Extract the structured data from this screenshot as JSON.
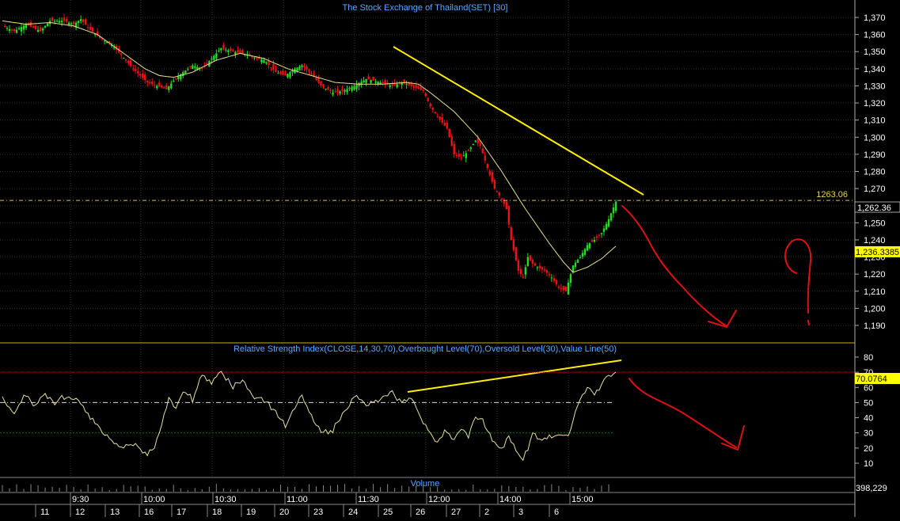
{
  "colors": {
    "background": "#000000",
    "grid": "#2f2f2f",
    "axis_text": "#ffffff",
    "title": "#5aa8ff",
    "up_candle": "#22dd22",
    "down_candle": "#ee1111",
    "moving_average": "#e8e090",
    "trendline": "#ffee00",
    "rsi_line": "#e8e0a0",
    "overbought": "#aa0000",
    "oversold": "#007700",
    "annotation": "#dd1111",
    "panel_border": "#c8b400"
  },
  "chart_data": [
    {
      "type": "candlestick",
      "title": "The Stock Exchange of Thailand(SET) [30]",
      "ylim": [
        1184,
        1377
      ],
      "yticks": [
        1190,
        1200,
        1210,
        1220,
        1230,
        1240,
        1250,
        1260,
        1270,
        1280,
        1290,
        1300,
        1310,
        1320,
        1330,
        1340,
        1350,
        1360,
        1370
      ],
      "yticklabels": [
        "1,190",
        "1,200",
        "1,210",
        "1,220",
        "1,230",
        "1,240",
        "1,250",
        "1,260",
        "1,270",
        "1,280",
        "1,290",
        "1,300",
        "1,310",
        "1,320",
        "1,330",
        "1,340",
        "1,350",
        "1,360",
        "1,370"
      ],
      "hline": {
        "value": 1263.06,
        "label": "1263.06"
      },
      "last_price_label": "1,262.36",
      "ma_label": "1,236.3385",
      "close_path": [
        [
          0,
          1365
        ],
        [
          5,
          1362
        ],
        [
          10,
          1366
        ],
        [
          16,
          1362
        ],
        [
          20,
          1368
        ],
        [
          26,
          1368
        ],
        [
          30,
          1366
        ],
        [
          33,
          1369
        ],
        [
          36,
          1364
        ],
        [
          41,
          1358
        ],
        [
          46,
          1354
        ],
        [
          50,
          1348
        ],
        [
          55,
          1340
        ],
        [
          58,
          1336
        ],
        [
          61,
          1332
        ],
        [
          65,
          1330
        ],
        [
          69,
          1328
        ],
        [
          72,
          1333
        ],
        [
          76,
          1338
        ],
        [
          80,
          1342
        ],
        [
          84,
          1340
        ],
        [
          88,
          1346
        ],
        [
          92,
          1352
        ],
        [
          97,
          1350
        ],
        [
          101,
          1349
        ],
        [
          105,
          1347
        ],
        [
          110,
          1345
        ],
        [
          115,
          1338
        ],
        [
          119,
          1336
        ],
        [
          123,
          1340
        ],
        [
          126,
          1342
        ],
        [
          130,
          1337
        ],
        [
          134,
          1330
        ],
        [
          139,
          1326
        ],
        [
          143,
          1327
        ],
        [
          148,
          1330
        ],
        [
          153,
          1334
        ],
        [
          159,
          1332
        ],
        [
          164,
          1330
        ],
        [
          168,
          1332
        ],
        [
          172,
          1330
        ],
        [
          177,
          1327
        ],
        [
          180,
          1318
        ],
        [
          183,
          1312
        ],
        [
          187,
          1305
        ],
        [
          190,
          1290
        ],
        [
          193,
          1288
        ],
        [
          196,
          1292
        ],
        [
          199,
          1298
        ],
        [
          201,
          1295
        ],
        [
          204,
          1282
        ],
        [
          207,
          1270
        ],
        [
          210,
          1264
        ],
        [
          212,
          1258
        ],
        [
          214,
          1240
        ],
        [
          217,
          1222
        ],
        [
          219,
          1218
        ],
        [
          221,
          1230
        ],
        [
          223,
          1226
        ],
        [
          225,
          1224
        ],
        [
          228,
          1222
        ],
        [
          231,
          1218
        ],
        [
          234,
          1212
        ],
        [
          237,
          1210
        ],
        [
          240,
          1225
        ],
        [
          243,
          1230
        ],
        [
          246,
          1237
        ],
        [
          249,
          1240
        ],
        [
          252,
          1244
        ],
        [
          255,
          1252
        ],
        [
          258,
          1262.36
        ]
      ],
      "moving_average_path": [
        [
          0,
          1368
        ],
        [
          10,
          1366
        ],
        [
          20,
          1367
        ],
        [
          30,
          1365
        ],
        [
          40,
          1360
        ],
        [
          50,
          1350
        ],
        [
          60,
          1340
        ],
        [
          66,
          1336
        ],
        [
          72,
          1335
        ],
        [
          80,
          1338
        ],
        [
          90,
          1345
        ],
        [
          100,
          1349
        ],
        [
          110,
          1346
        ],
        [
          120,
          1340
        ],
        [
          130,
          1336
        ],
        [
          140,
          1332
        ],
        [
          150,
          1331
        ],
        [
          160,
          1331
        ],
        [
          170,
          1332
        ],
        [
          175,
          1331
        ],
        [
          180,
          1326
        ],
        [
          190,
          1315
        ],
        [
          200,
          1300
        ],
        [
          210,
          1280
        ],
        [
          220,
          1258
        ],
        [
          230,
          1238
        ],
        [
          236,
          1227
        ],
        [
          240,
          1221
        ],
        [
          246,
          1224
        ],
        [
          252,
          1229
        ],
        [
          258,
          1236.34
        ]
      ]
    },
    {
      "type": "line",
      "title": "Relative Strength Index(CLOSE,14,30,70),Overbought Level(70),Oversold Level(30),Value Line(50)",
      "ylim": [
        0,
        92
      ],
      "yticks": [
        10,
        20,
        30,
        40,
        50,
        60,
        70,
        80
      ],
      "yticklabels": [
        "10",
        "20",
        "30",
        "40",
        "50",
        "60",
        "70",
        "80"
      ],
      "levels": {
        "overbought": 70,
        "oversold": 30,
        "value_line": 50
      },
      "last_value_label": "70.0764",
      "series": [
        {
          "values": [
            [
              0,
              54
            ],
            [
              5,
              42
            ],
            [
              9,
              55
            ],
            [
              14,
              48
            ],
            [
              18,
              56
            ],
            [
              22,
              50
            ],
            [
              25,
              54
            ],
            [
              30,
              52
            ],
            [
              34,
              48
            ],
            [
              38,
              38
            ],
            [
              42,
              30
            ],
            [
              47,
              24
            ],
            [
              51,
              20
            ],
            [
              55,
              23
            ],
            [
              58,
              20
            ],
            [
              61,
              16
            ],
            [
              64,
              20
            ],
            [
              67,
              35
            ],
            [
              70,
              52
            ],
            [
              73,
              45
            ],
            [
              76,
              58
            ],
            [
              80,
              52
            ],
            [
              84,
              68
            ],
            [
              88,
              64
            ],
            [
              92,
              70
            ],
            [
              97,
              60
            ],
            [
              101,
              66
            ],
            [
              105,
              55
            ],
            [
              110,
              52
            ],
            [
              115,
              44
            ],
            [
              119,
              34
            ],
            [
              123,
              46
            ],
            [
              126,
              55
            ],
            [
              130,
              40
            ],
            [
              134,
              30
            ],
            [
              139,
              32
            ],
            [
              143,
              42
            ],
            [
              148,
              55
            ],
            [
              153,
              48
            ],
            [
              159,
              52
            ],
            [
              164,
              56
            ],
            [
              168,
              50
            ],
            [
              172,
              54
            ],
            [
              177,
              36
            ],
            [
              180,
              30
            ],
            [
              183,
              24
            ],
            [
              186,
              32
            ],
            [
              190,
              24
            ],
            [
              193,
              34
            ],
            [
              196,
              28
            ],
            [
              199,
              42
            ],
            [
              202,
              38
            ],
            [
              205,
              28
            ],
            [
              207,
              24
            ],
            [
              210,
              20
            ],
            [
              213,
              28
            ],
            [
              217,
              15
            ],
            [
              219,
              12
            ],
            [
              221,
              20
            ],
            [
              223,
              30
            ],
            [
              226,
              24
            ],
            [
              229,
              28
            ],
            [
              232,
              26
            ],
            [
              235,
              30
            ],
            [
              238,
              28
            ],
            [
              240,
              38
            ],
            [
              243,
              52
            ],
            [
              246,
              60
            ],
            [
              249,
              55
            ],
            [
              252,
              62
            ],
            [
              255,
              68
            ],
            [
              258,
              70.08
            ]
          ]
        }
      ]
    },
    {
      "type": "bar",
      "title": "Volume",
      "last_value_label": "398,229"
    }
  ],
  "x_axis": {
    "time_labels": [
      "9:30",
      "10:00",
      "10:30",
      "11:00",
      "11:30",
      "12:00",
      "14:00",
      "15:00"
    ],
    "date_labels": [
      "11",
      "12",
      "13",
      "16",
      "17",
      "18",
      "19",
      "20",
      "23",
      "24",
      "25",
      "26",
      "27",
      "2",
      "3",
      "6"
    ]
  }
}
